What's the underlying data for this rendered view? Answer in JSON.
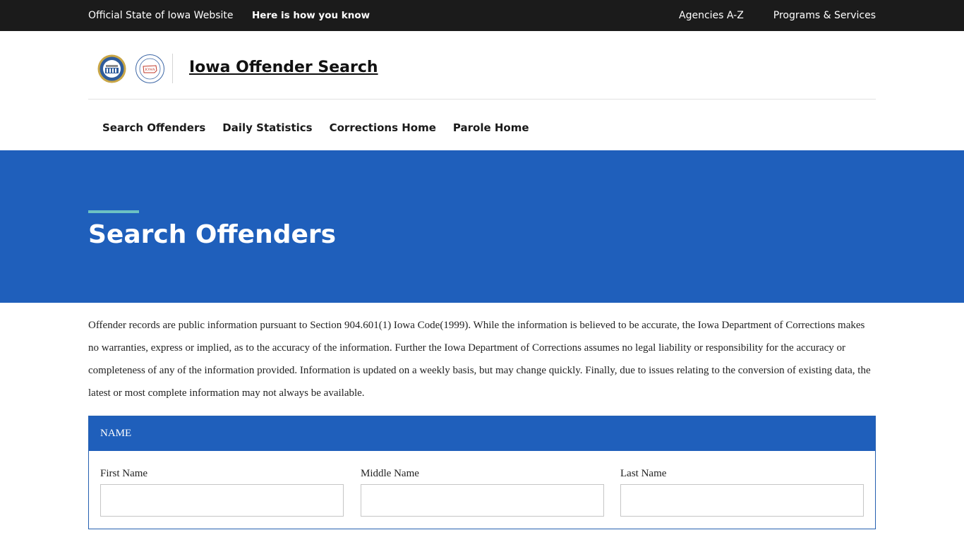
{
  "topbar": {
    "official_label": "Official State of Iowa Website",
    "how_label": "Here is how you know",
    "agencies_label": "Agencies A-Z",
    "programs_label": "Programs & Services"
  },
  "header": {
    "seals": [
      "doc-seal-icon",
      "parole-board-seal-icon"
    ],
    "seal_2_text": "IOWA",
    "title": "Iowa Offender Search"
  },
  "nav": {
    "items": [
      {
        "label": "Search Offenders"
      },
      {
        "label": "Daily Statistics"
      },
      {
        "label": "Corrections Home"
      },
      {
        "label": "Parole Home"
      }
    ]
  },
  "hero": {
    "title": "Search Offenders"
  },
  "disclaimer": {
    "text": "Offender records are public information pursuant to Section 904.601(1) Iowa Code(1999). While the information is believed to be accurate, the Iowa Department of Corrections makes no warranties, express or implied, as to the accuracy of the information. Further the Iowa Department of Corrections assumes no legal liability or responsibility for the accuracy or completeness of any of the information provided. Information is updated on a weekly basis, but may change quickly. Finally, due to issues relating to the conversion of existing data, the latest or most complete information may not always be available."
  },
  "name_panel": {
    "heading": "NAME",
    "fields": {
      "first": {
        "label": "First Name",
        "value": ""
      },
      "middle": {
        "label": "Middle Name",
        "value": ""
      },
      "last": {
        "label": "Last Name",
        "value": ""
      }
    }
  },
  "colors": {
    "topbar_bg": "#1b1b1b",
    "brand_blue": "#1f5fbb",
    "accent_teal": "#6cc1c3"
  }
}
